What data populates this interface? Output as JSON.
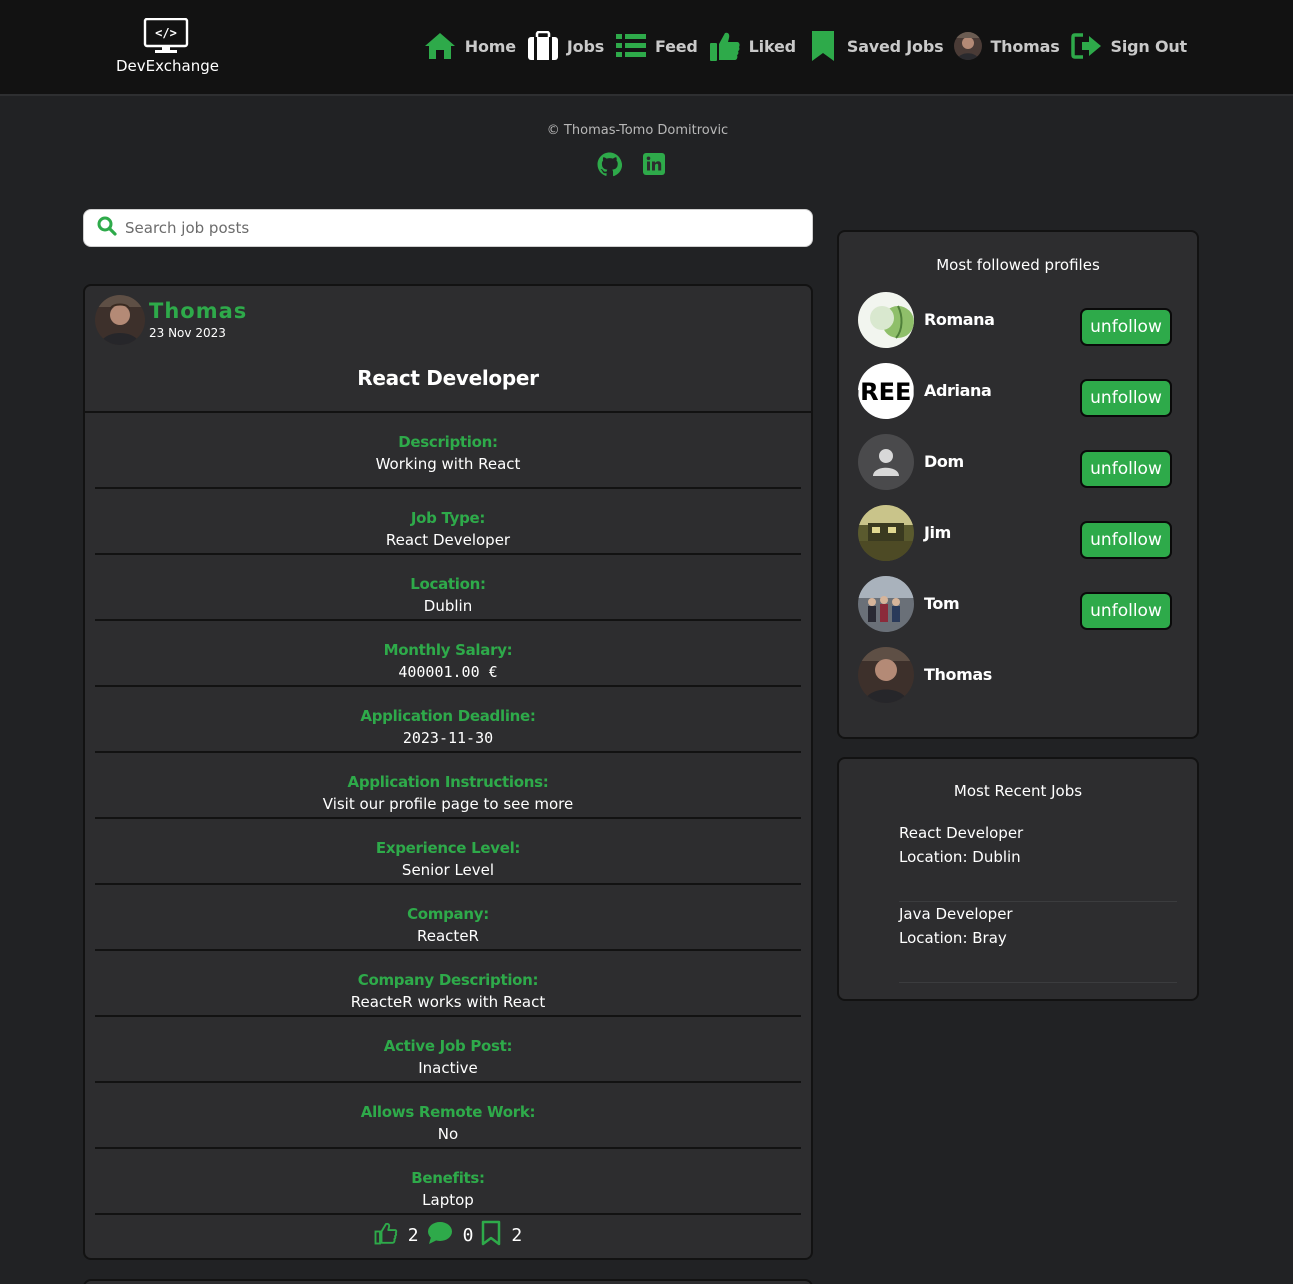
{
  "brand": {
    "name": "DevExchange",
    "logo_icon": "code-monitor-icon"
  },
  "nav": {
    "home": "Home",
    "jobs": "Jobs",
    "feed": "Feed",
    "liked": "Liked",
    "saved_jobs": "Saved Jobs",
    "profile": "Thomas",
    "sign_out": "Sign Out"
  },
  "footer": {
    "copyright": "© Thomas-Tomo Domitrovic",
    "social": [
      "github-icon",
      "linkedin-icon"
    ]
  },
  "search": {
    "placeholder": "Search job posts",
    "value": ""
  },
  "post": {
    "author": "Thomas",
    "date": "23 Nov 2023",
    "title": "React Developer",
    "fields": [
      {
        "label": "Description:",
        "value": "Working with React"
      },
      {
        "label": "Job Type:",
        "value": "React Developer"
      },
      {
        "label": "Location:",
        "value": "Dublin"
      },
      {
        "label": "Monthly Salary:",
        "value": "400001.00 €"
      },
      {
        "label": "Application Deadline:",
        "value": "2023-11-30"
      },
      {
        "label": "Application Instructions:",
        "value": "Visit our profile page to see more"
      },
      {
        "label": "Experience Level:",
        "value": "Senior Level"
      },
      {
        "label": "Company:",
        "value": "ReacteR"
      },
      {
        "label": "Company Description:",
        "value": "ReacteR works with React"
      },
      {
        "label": "Active Job Post:",
        "value": "Inactive"
      },
      {
        "label": "Allows Remote Work:",
        "value": "No"
      },
      {
        "label": "Benefits:",
        "value": "Laptop"
      }
    ],
    "likes": "2",
    "comments": "0",
    "saves": "2"
  },
  "most_followed": {
    "title": "Most followed profiles",
    "profiles": [
      {
        "name": "Romana",
        "button": "unfollow"
      },
      {
        "name": "Adriana",
        "button": "unfollow"
      },
      {
        "name": "Dom",
        "button": "unfollow"
      },
      {
        "name": "Jim",
        "button": "unfollow"
      },
      {
        "name": "Tom",
        "button": "unfollow"
      },
      {
        "name": "Thomas",
        "button": ""
      }
    ]
  },
  "recent_jobs": {
    "title": "Most Recent Jobs",
    "jobs": [
      {
        "title": "React Developer",
        "location": "Location: Dublin"
      },
      {
        "title": "Java Developer",
        "location": "Location: Bray"
      }
    ]
  },
  "colors": {
    "accent": "#2eaa4a",
    "background": "#212224",
    "card": "#2d2d2f",
    "navbar": "#121212"
  }
}
